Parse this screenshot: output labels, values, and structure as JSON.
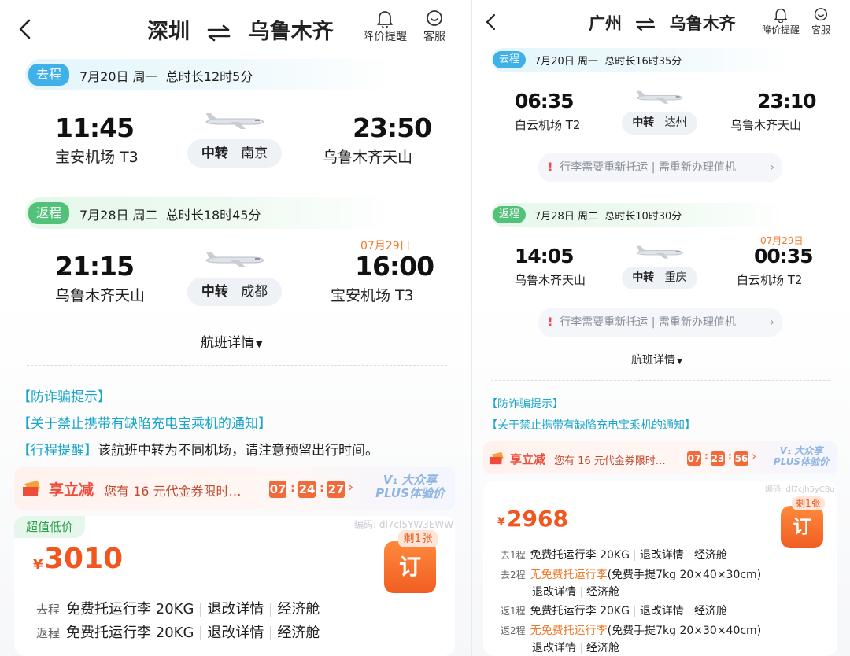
{
  "left": {
    "header": {
      "from": "深圳",
      "to": "乌鲁木齐",
      "swap_icon": "swap-arrows-icon",
      "price_alert": "降价提醒",
      "service": "客服"
    },
    "outbound": {
      "tag": "去程",
      "info": "7月20日 周一  总时长12时5分",
      "dep_time": "11:45",
      "dep_airport": "宝安机场 T3",
      "transfer_label": "中转",
      "transfer_city": "南京",
      "arr_time": "23:50",
      "arr_airport": "乌鲁木齐天山"
    },
    "return": {
      "tag": "返程",
      "info": "7月28日 周二  总时长18时45分",
      "dep_time": "21:15",
      "dep_airport": "乌鲁木齐天山",
      "transfer_label": "中转",
      "transfer_city": "成都",
      "next_day": "07月29日",
      "arr_time": "16:00",
      "arr_airport": "宝安机场 T3"
    },
    "details": "航班详情",
    "tips": {
      "fraud": "【防诈骗提示】",
      "powerbank": "【关于禁止携带有缺陷充电宝乘机的通知】",
      "reminder_tag": "【行程提醒】",
      "reminder_text": "该航班中转为不同机场，请注意预留出行时间。"
    },
    "coupon": {
      "label": "享立减",
      "text": "您有 16 元代金券限时…",
      "h": "07",
      "m": "24",
      "s": "27",
      "plus_line1": "V₁ 大众享",
      "plus_line2": "PLUS体验价"
    },
    "price_card": {
      "badge": "超值低价",
      "watermark": "编码: dl7cl5YW3EWW",
      "currency": "¥",
      "price": "3010",
      "remaining": "剩1张",
      "book": "订",
      "rows": [
        {
          "tag": "去程",
          "baggage": "免费托运行李 20KG",
          "refund": "退改详情",
          "cabin": "经济舱"
        },
        {
          "tag": "返程",
          "baggage": "免费托运行李 20KG",
          "refund": "退改详情",
          "cabin": "经济舱"
        }
      ]
    }
  },
  "right": {
    "header": {
      "from": "广州",
      "to": "乌鲁木齐",
      "price_alert": "降价提醒",
      "service": "客服"
    },
    "outbound": {
      "tag": "去程",
      "info": "7月20日 周一  总时长16时35分",
      "dep_time": "06:35",
      "dep_airport": "白云机场 T2",
      "transfer_label": "中转",
      "transfer_city": "达州",
      "arr_time": "23:10",
      "arr_airport": "乌鲁木齐天山",
      "notice": "行李需要重新托运 | 需重新办理值机"
    },
    "return": {
      "tag": "返程",
      "info": "7月28日 周二  总时长10时30分",
      "dep_time": "14:05",
      "dep_airport": "乌鲁木齐天山",
      "transfer_label": "中转",
      "transfer_city": "重庆",
      "next_day": "07月29日",
      "arr_time": "00:35",
      "arr_airport": "白云机场 T2",
      "notice": "行李需要重新托运 | 需重新办理值机"
    },
    "details": "航班详情",
    "tips": {
      "fraud": "【防诈骗提示】",
      "powerbank": "【关于禁止携带有缺陷充电宝乘机的通知】"
    },
    "coupon": {
      "label": "享立减",
      "text": "您有 16 元代金券限时…",
      "h": "07",
      "m": "23",
      "s": "56",
      "plus_line1": "V₁ 大众享",
      "plus_line2": "PLUS体验价"
    },
    "price_card": {
      "watermark": "编码: dl7cjh5yC8u",
      "currency": "¥",
      "price": "2968",
      "remaining": "剩1张",
      "book": "订",
      "rows": [
        {
          "tag": "去1程",
          "baggage": "免费托运行李 20KG",
          "refund": "退改详情",
          "cabin": "经济舱"
        },
        {
          "tag": "去2程",
          "no_bag": "无免费托运行李",
          "hand": "(免费手提7kg 20×40×30cm)",
          "refund": "退改详情",
          "cabin": "经济舱"
        },
        {
          "tag": "返1程",
          "baggage": "免费托运行李 20KG",
          "refund": "退改详情",
          "cabin": "经济舱"
        },
        {
          "tag": "返2程",
          "no_bag": "无免费托运行李",
          "hand": "(免费手提7kg 20×30×40cm)",
          "refund": "退改详情",
          "cabin": "经济舱"
        }
      ]
    }
  }
}
